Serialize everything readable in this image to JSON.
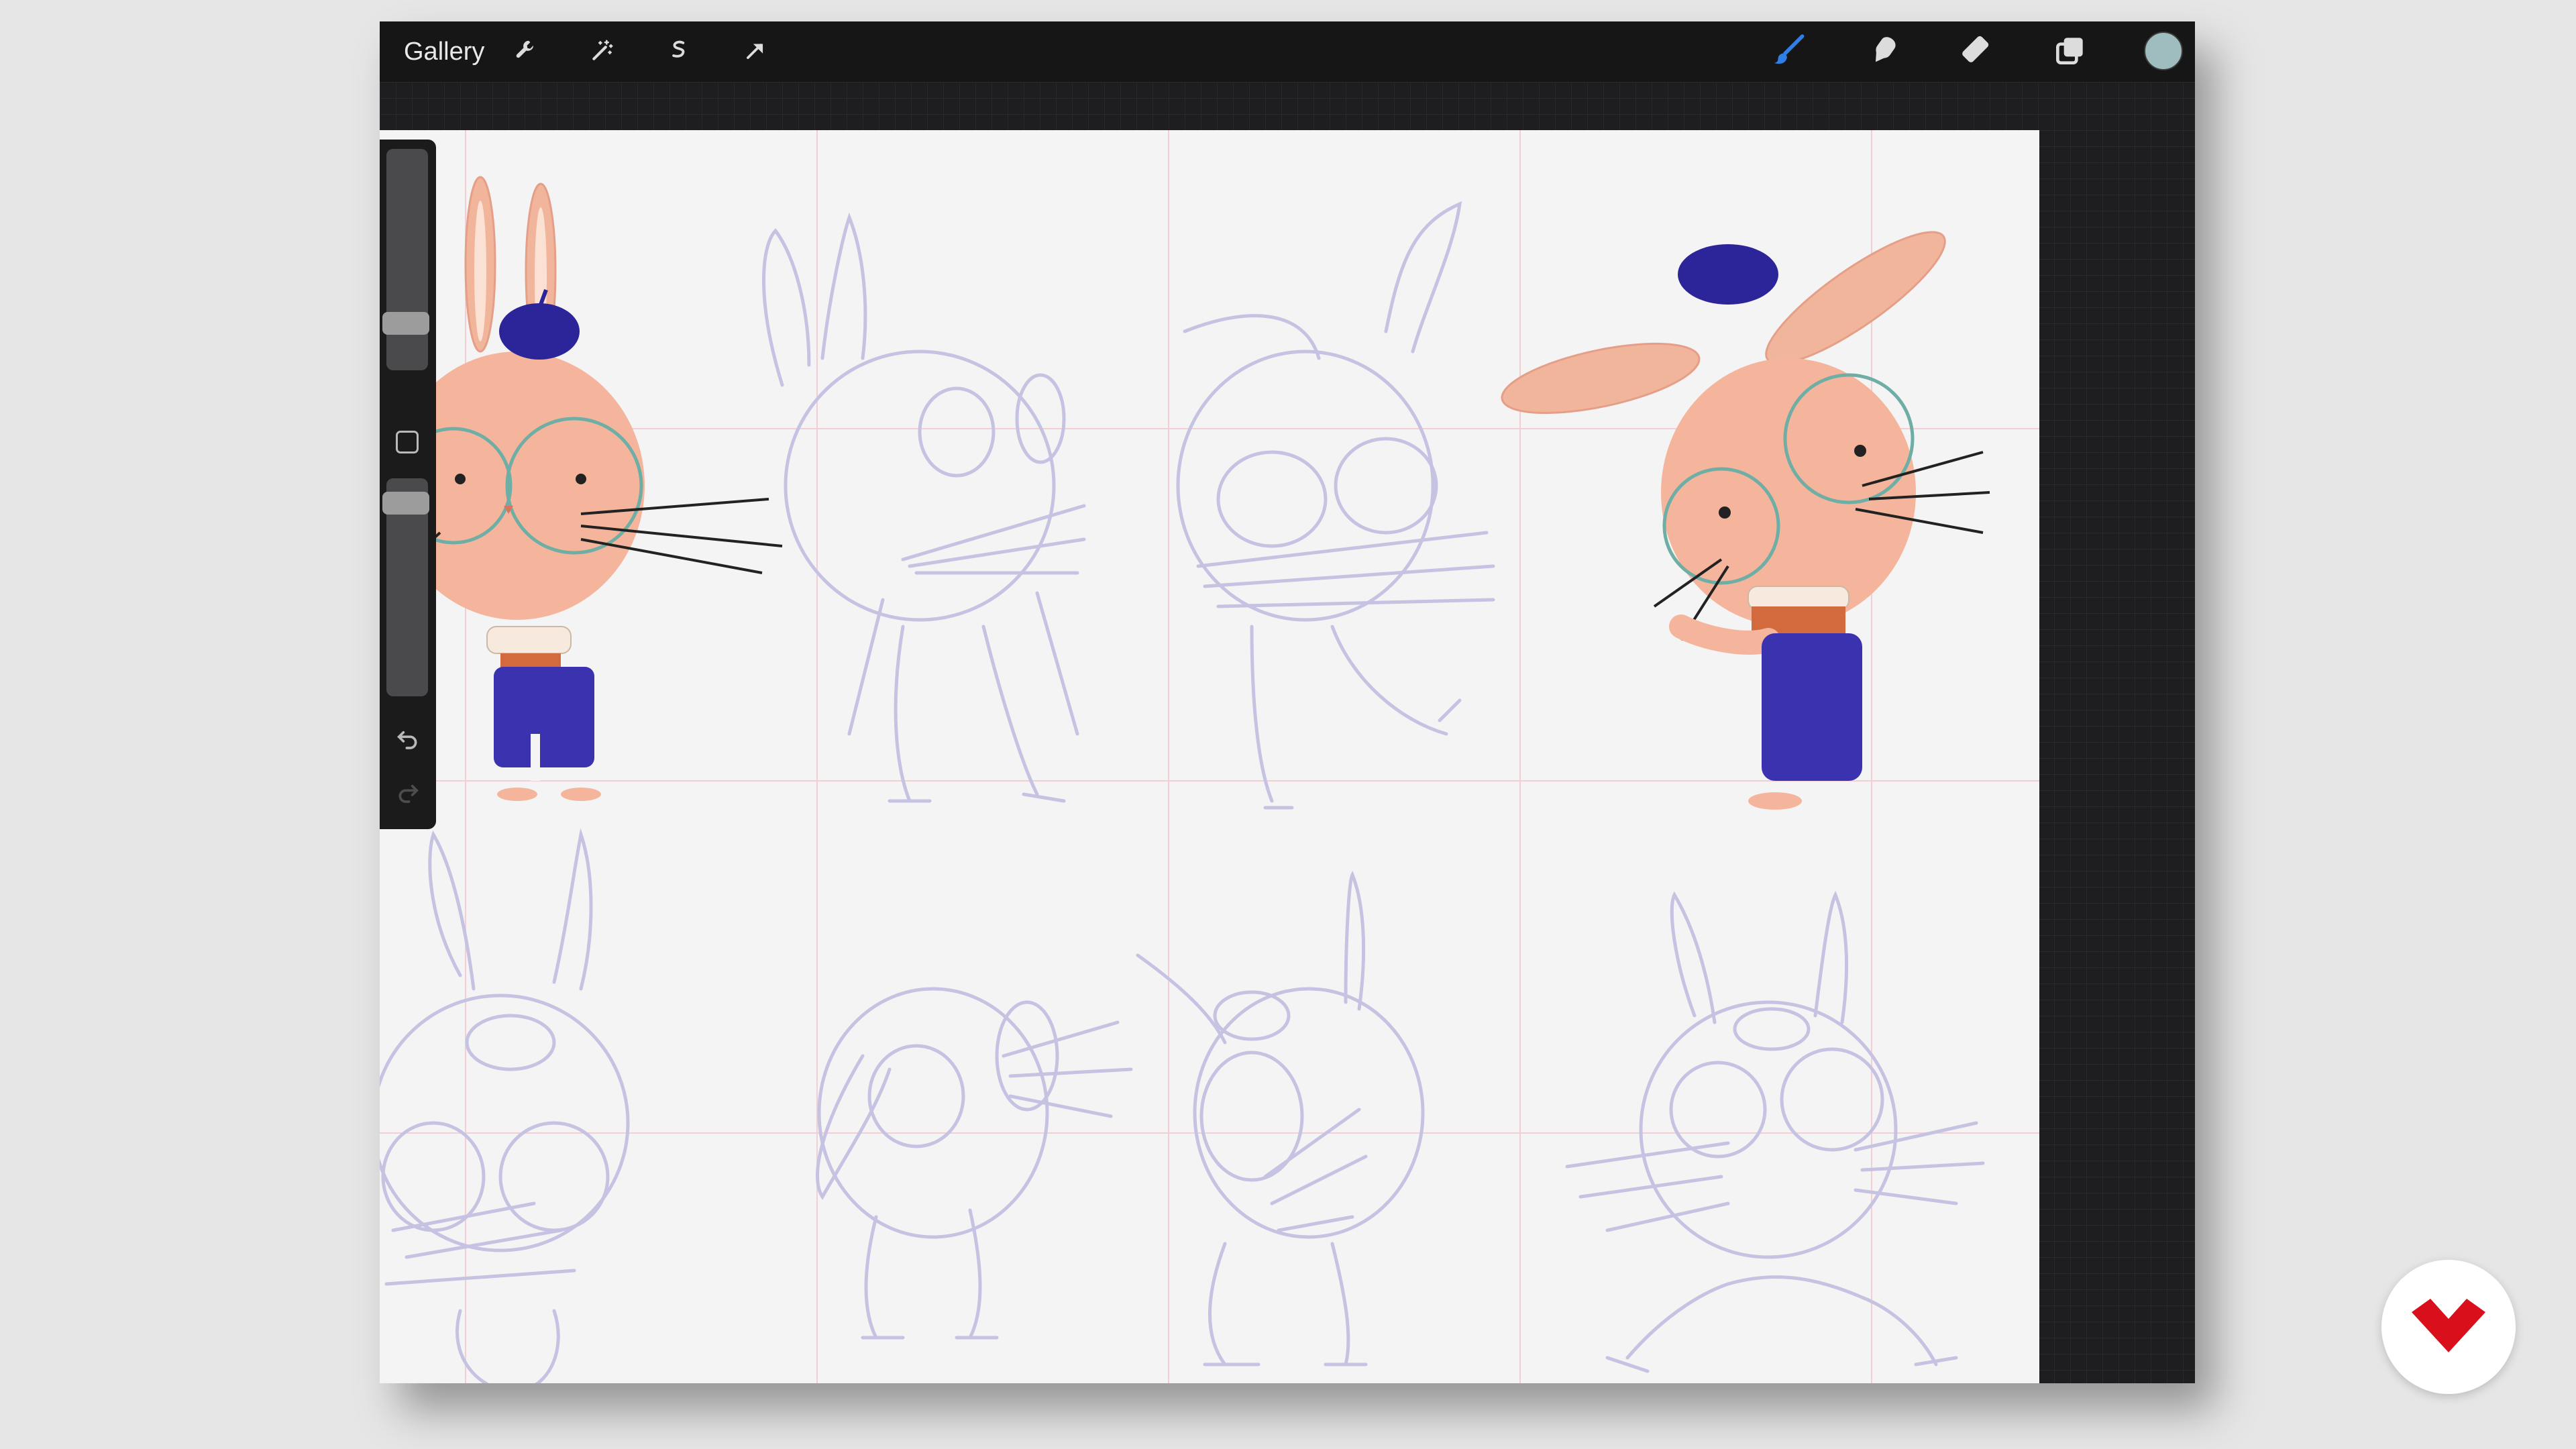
{
  "toolbar": {
    "gallery_label": "Gallery"
  },
  "icons": {
    "left_tools": [
      "wrench-icon",
      "magic-wand-icon",
      "selection-icon",
      "move-arrow-icon"
    ],
    "right_tools": [
      "brush-icon",
      "smudge-icon",
      "eraser-icon",
      "layers-icon"
    ],
    "sidebar": [
      "modify-square-icon",
      "undo-icon",
      "redo-icon"
    ],
    "badge": "brand-logo-icon"
  },
  "colors": {
    "current_color": "#9fbcbe",
    "active_tool": "#2f7fe6",
    "badge_brand": "#d90f1c",
    "sketch_stroke": "#c5c2e2",
    "bunny_face": "#f4b59c",
    "overalls": "#3b32b0",
    "beret": "#2c2499"
  },
  "sidebar": {
    "brush_size": 0.18,
    "opacity": 0.93
  }
}
